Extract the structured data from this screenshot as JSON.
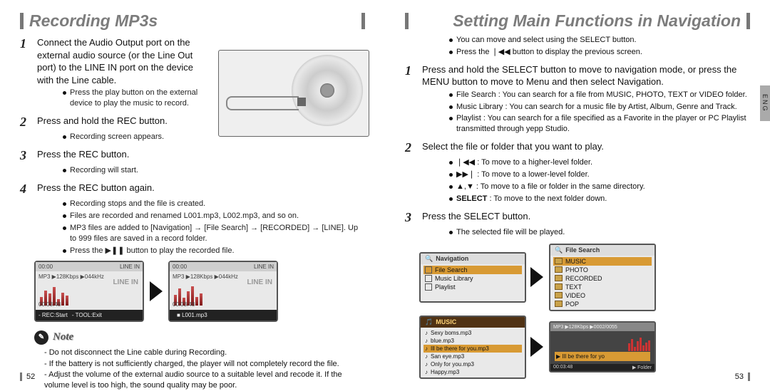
{
  "left": {
    "title": "Recording MP3s",
    "step1": "Connect the Audio Output port on the external audio source (or the Line Out port) to the LINE IN port on the device with the Line cable.",
    "step1_sub": "Press the play button on the external device to play the music to record.",
    "step2": "Press and hold the REC button.",
    "step2_sub": "Recording screen appears.",
    "step3": "Press the REC button.",
    "step3_sub": "Recording will start.",
    "step4": "Press the REC button again.",
    "step4_subs": [
      "Recording stops and the file is created.",
      "Files are recorded and renamed L001.mp3, L002.mp3, and so on.",
      "MP3 files are added to [Navigation]  → [File Search]  → [RECORDED]  → [LINE]. Up to 999 files are saved in a record folder.",
      "Press the  ▶❚❚ button to play the recorded file."
    ],
    "screen_top_time": "00:00",
    "screen_top_mode": "LINE IN",
    "screen_line": "MP3 ▶128Kbps ▶044kHz",
    "screen_label": "LINE IN",
    "screen1_time": "00:03:48",
    "screen1_foot_rec": "- REC:Start",
    "screen1_foot_tool": "- TOOL:Exit",
    "screen2_foot": "L001.mp3",
    "note_title": "Note",
    "notes": [
      "- Do not disconnect the Line cable during Recording.",
      "- If the battery is not sufficiently charged, the player will not completely record the file.",
      "- Adjust the volume of the external audio source to a suitable level and recode it. If the volume level is too high, the sound quality may be poor."
    ],
    "pagenum": "52"
  },
  "right": {
    "title": "Setting Main Functions in Navigation",
    "lang": "ENG",
    "intro": [
      "You can move and select using the SELECT button.",
      "Press the  ❘◀◀  button to display the previous screen."
    ],
    "step1": "Press and hold the SELECT button to move to navigation mode, or press the MENU button to move to Menu and then select Navigation.",
    "step1_subs": [
      "File Search : You can search for a file from MUSIC, PHOTO, TEXT or VIDEO folder.",
      "Music Library : You can search for a music file by Artist, Album, Genre and Track.",
      "Playlist : You can search for a file specified as a Favorite in the player or PC Playlist transmitted through yepp Studio."
    ],
    "step2": "Select the file or folder that you want to play.",
    "step2_subs": [
      "❘◀◀  : To move to a higher-level folder.",
      "▶▶❘  : To move to a lower-level folder.",
      "▲,▼  : To move to a file or folder in the same directory.",
      "SELECT : To move to the next folder down."
    ],
    "step3": "Press the SELECT button.",
    "step3_sub": "The selected file will be played.",
    "panels": {
      "nav_title": "Navigation",
      "nav_items": [
        "File Search",
        "Music Library",
        "Playlist"
      ],
      "fs_title": "File Search",
      "fs_items": [
        "MUSIC",
        "PHOTO",
        "RECORDED",
        "TEXT",
        "VIDEO",
        "POP"
      ],
      "music_title": "MUSIC",
      "music_items": [
        "Sexy boms.mp3",
        "blue.mp3",
        "Ill be there for you.mp3",
        "San eye.mp3",
        "Only for you.mp3",
        "Happy.mp3"
      ],
      "player_line": "MP3 ▶128Kbps ▶0002/0055",
      "player_track": "▶ Ill be there for yo",
      "player_time": "00:03:48",
      "player_folder": "▶ Folder"
    },
    "pagenum": "53"
  }
}
